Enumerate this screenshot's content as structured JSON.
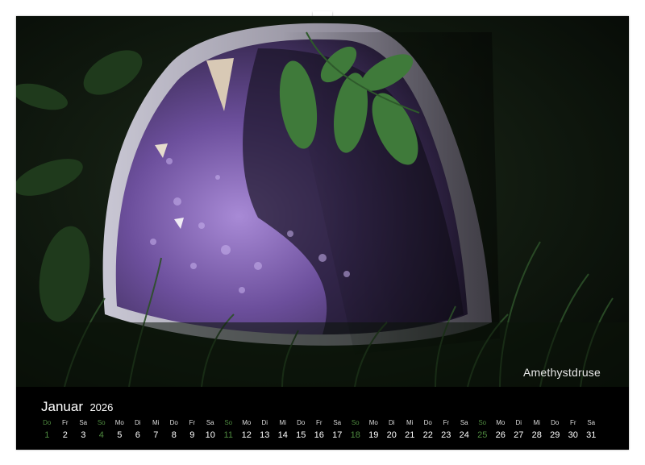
{
  "caption": "Amethystdruse",
  "calendar": {
    "month": "Januar",
    "year": "2026",
    "weekdays": [
      "Do",
      "Fr",
      "Sa",
      "So",
      "Mo",
      "Di",
      "Mi",
      "Do",
      "Fr",
      "Sa",
      "So",
      "Mo",
      "Di",
      "Mi",
      "Do",
      "Fr",
      "Sa",
      "So",
      "Mo",
      "Di",
      "Mi",
      "Do",
      "Fr",
      "Sa",
      "So",
      "Mo",
      "Di",
      "Mi",
      "Do",
      "Fr",
      "Sa"
    ],
    "days": [
      "1",
      "2",
      "3",
      "4",
      "5",
      "6",
      "7",
      "8",
      "9",
      "10",
      "11",
      "12",
      "13",
      "14",
      "15",
      "16",
      "17",
      "18",
      "19",
      "20",
      "21",
      "22",
      "23",
      "24",
      "25",
      "26",
      "27",
      "28",
      "29",
      "30",
      "31"
    ],
    "sunday_indices": [
      0,
      3,
      10,
      17,
      24
    ],
    "colors": {
      "sunday": "#4e8a3f",
      "text": "#ffffff",
      "background": "#000000"
    }
  }
}
